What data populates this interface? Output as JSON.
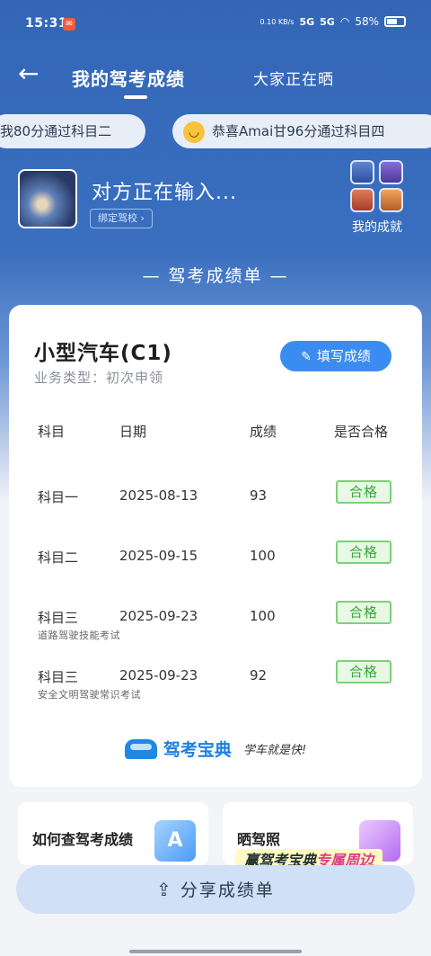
{
  "status_bar": {
    "time": "15:31",
    "net_speed": "0.10 KB/s",
    "signal1": "5G",
    "signal2": "5G",
    "battery": "58%"
  },
  "nav": {
    "back_icon": "arrow-left-icon",
    "active_tab": "我的驾考成绩",
    "other_tab": "大家正在晒"
  },
  "ticker": {
    "item1": "我80分通过科目二",
    "item2": "恭喜Amai甘96分通过科目四"
  },
  "profile": {
    "name": "对方正在输入...",
    "bind_label": "绑定驾校 ›",
    "achievement_label": "我的成就"
  },
  "section_title": "— 驾考成绩单 —",
  "card": {
    "car_type": "小型汽车(C1)",
    "business_type": "业务类型：初次申领",
    "fill_button": "填写成绩",
    "headers": [
      "科目",
      "日期",
      "成绩",
      "是否合格"
    ],
    "rows": [
      {
        "subject": "科目一",
        "date": "2025-08-13",
        "score": "93",
        "status": "合格",
        "sub": ""
      },
      {
        "subject": "科目二",
        "date": "2025-09-15",
        "score": "100",
        "status": "合格",
        "sub": ""
      },
      {
        "subject": "科目三",
        "date": "2025-09-23",
        "score": "100",
        "status": "合格",
        "sub": "道路驾驶技能考试"
      },
      {
        "subject": "科目三",
        "date": "2025-09-23",
        "score": "92",
        "status": "合格",
        "sub": "安全文明驾驶常识考试"
      }
    ],
    "brand_name": "驾考宝典",
    "brand_slogan": "学车就是快!"
  },
  "bottom": {
    "card1": "如何查驾考成绩",
    "card2": "晒驾照",
    "promo_prefix": "赢驾考宝典",
    "promo_highlight": "专属周边"
  },
  "share_button": "分享成绩单",
  "colors": {
    "primary": "#3b8cf0",
    "pass_green": "#3aa63a",
    "hero_blue": "#3366b7"
  }
}
